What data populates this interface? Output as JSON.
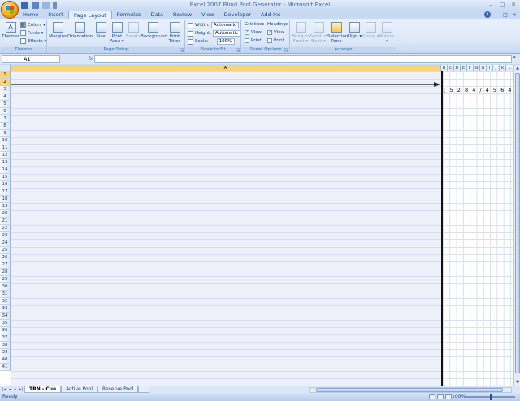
{
  "window": {
    "title": "Excel 2007 Blind Pool Generator - Microsoft Excel",
    "controls": [
      "–",
      "□",
      "✕"
    ]
  },
  "tabs": [
    "Home",
    "Insert",
    "Page Layout",
    "Formulas",
    "Data",
    "Review",
    "View",
    "Developer",
    "Add-Ins"
  ],
  "active_tab": "Page Layout",
  "ribbon": {
    "themes": {
      "name": "Themes",
      "themes_label": "Themes",
      "colors": "Colors ▾",
      "fonts": "Fonts ▾",
      "effects": "Effects ▾"
    },
    "page_setup": {
      "name": "Page Setup",
      "margins": "Margins",
      "orientation": "Orientation",
      "size": "Size",
      "print_area": "Print Area ▾",
      "breaks": "Breaks",
      "background": "Background",
      "print_titles": "Print Titles"
    },
    "scale_to_fit": {
      "name": "Scale to Fit",
      "width_label": "Width:",
      "width_value": "Automatic",
      "height_label": "Height:",
      "height_value": "Automatic",
      "scale_label": "Scale:",
      "scale_value": "100%"
    },
    "sheet_options": {
      "name": "Sheet Options",
      "gridlines": "Gridlines",
      "headings": "Headings",
      "view": "View",
      "print": "Print"
    },
    "arrange": {
      "name": "Arrange",
      "bring_to_front": "Bring to Front ▾",
      "send_to_back": "Send to Back ▾",
      "selection_pane": "Selection Pane",
      "align": "Align ▾",
      "group": "Group ▾",
      "rotate": "Rotate ▾"
    }
  },
  "formula_bar": {
    "name_box": "A1",
    "fx": "fx",
    "formula": ""
  },
  "columns": [
    "A",
    "B",
    "C",
    "D",
    "E",
    "F",
    "G",
    "H",
    "I",
    "J",
    "K",
    "L"
  ],
  "selected_column": "A",
  "rows": [
    "1",
    "2",
    "3",
    "4",
    "5",
    "6",
    "7",
    "8",
    "9",
    "10",
    "11",
    "12",
    "13",
    "14",
    "15",
    "16",
    "17",
    "18",
    "19",
    "20",
    "21",
    "22",
    "23",
    "24",
    "25",
    "26",
    "27",
    "28",
    "29",
    "30",
    "31",
    "32",
    "33",
    "34",
    "35",
    "36",
    "37",
    "38",
    "39",
    "40",
    "41"
  ],
  "sequence_text": "[ 5 2 8 4 / 4 5 6 4 ]",
  "sheets": [
    "TRN - Cue",
    "Active Pool",
    "Reserve Pool"
  ],
  "active_sheet": "TRN - Cue",
  "status": {
    "text": "Ready",
    "zoom": "100%"
  }
}
